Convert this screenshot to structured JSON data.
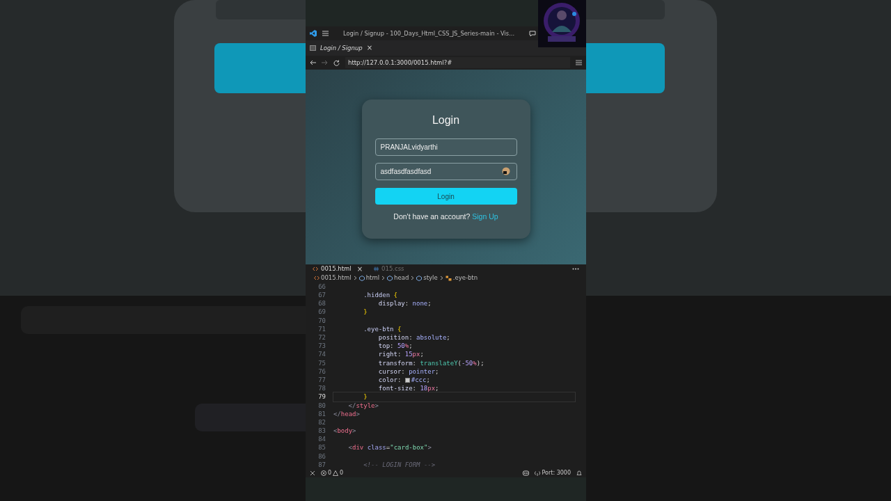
{
  "window": {
    "title": "Login / Signup - 100_Days_Html_CSS_JS_Series-main - Vis..."
  },
  "browser_tab": {
    "label": "Login / Signup",
    "close": "×"
  },
  "address_bar": {
    "url": "http://127.0.0.1:3000/0015.html?#"
  },
  "login_card": {
    "title": "Login",
    "username": {
      "value": "PRANJALvidyarthi"
    },
    "password": {
      "value": "asdfasdfasdfasd"
    },
    "button": "Login",
    "prompt": "Don't have an account?",
    "link": "Sign Up"
  },
  "editor_tabs": [
    {
      "label": "0015.html",
      "kind": "html",
      "selected": true,
      "close": "×"
    },
    {
      "label": "015.css",
      "kind": "css",
      "selected": false
    }
  ],
  "breadcrumb": [
    {
      "label": "0015.html",
      "kind": "file"
    },
    {
      "label": "html",
      "kind": "element"
    },
    {
      "label": "head",
      "kind": "element"
    },
    {
      "label": "style",
      "kind": "element"
    },
    {
      "label": ".eye-btn",
      "kind": "rule"
    }
  ],
  "code": [
    {
      "number": "66",
      "current": false
    },
    {
      "number": "67",
      "current": false,
      "kind": "level2",
      "tokens": [
        {
          "kind": "selector",
          "text": ".hidden"
        },
        {
          "kind": "brace",
          "text": " {"
        }
      ]
    },
    {
      "number": "68",
      "current": false,
      "kind": "level3",
      "tokens": [
        {
          "kind": "property",
          "text": "display"
        },
        {
          "kind": "punct",
          "text": ": "
        },
        {
          "kind": "value",
          "text": "none"
        },
        {
          "kind": "punct",
          "text": ";"
        }
      ]
    },
    {
      "number": "69",
      "current": false,
      "kind": "level2",
      "tokens": [
        {
          "kind": "brace",
          "text": "}"
        }
      ]
    },
    {
      "number": "70",
      "current": false
    },
    {
      "number": "71",
      "current": false,
      "kind": "level2",
      "tokens": [
        {
          "kind": "selector",
          "text": ".eye-btn"
        },
        {
          "kind": "brace",
          "text": " {"
        }
      ]
    },
    {
      "number": "72",
      "current": false,
      "kind": "level3",
      "tokens": [
        {
          "kind": "property",
          "text": "position"
        },
        {
          "kind": "punct",
          "text": ": "
        },
        {
          "kind": "value",
          "text": "absolute"
        },
        {
          "kind": "punct",
          "text": ";"
        }
      ]
    },
    {
      "number": "73",
      "current": false,
      "kind": "level3",
      "tokens": [
        {
          "kind": "property",
          "text": "top"
        },
        {
          "kind": "punct",
          "text": ": "
        },
        {
          "kind": "number",
          "text": "50"
        },
        {
          "kind": "unit",
          "text": "%"
        },
        {
          "kind": "punct",
          "text": ";"
        }
      ]
    },
    {
      "number": "74",
      "current": false,
      "kind": "level3",
      "tokens": [
        {
          "kind": "property",
          "text": "right"
        },
        {
          "kind": "punct",
          "text": ": "
        },
        {
          "kind": "number",
          "text": "15"
        },
        {
          "kind": "unit",
          "text": "px"
        },
        {
          "kind": "punct",
          "text": ";"
        }
      ]
    },
    {
      "number": "75",
      "current": false,
      "kind": "level3",
      "tokens": [
        {
          "kind": "property",
          "text": "transform"
        },
        {
          "kind": "punct",
          "text": ": "
        },
        {
          "kind": "function",
          "text": "translateY"
        },
        {
          "kind": "punct",
          "text": "("
        },
        {
          "kind": "number",
          "text": "-50"
        },
        {
          "kind": "unit",
          "text": "%"
        },
        {
          "kind": "punct",
          "text": ");"
        }
      ]
    },
    {
      "number": "76",
      "current": false,
      "kind": "level3",
      "tokens": [
        {
          "kind": "property",
          "text": "cursor"
        },
        {
          "kind": "punct",
          "text": ": "
        },
        {
          "kind": "value",
          "text": "pointer"
        },
        {
          "kind": "punct",
          "text": ";"
        }
      ]
    },
    {
      "number": "77",
      "current": false,
      "kind": "level3",
      "tokens": [
        {
          "kind": "property",
          "text": "color"
        },
        {
          "kind": "punct",
          "text": ": "
        },
        {
          "kind": "swatch",
          "color": "#cccccc"
        },
        {
          "kind": "value",
          "text": "#ccc"
        },
        {
          "kind": "punct",
          "text": ";"
        }
      ]
    },
    {
      "number": "78",
      "current": false,
      "kind": "level3",
      "tokens": [
        {
          "kind": "property",
          "text": "font-size"
        },
        {
          "kind": "punct",
          "text": ": "
        },
        {
          "kind": "number",
          "text": "18"
        },
        {
          "kind": "unit",
          "text": "px"
        },
        {
          "kind": "punct",
          "text": ";"
        }
      ]
    },
    {
      "number": "79",
      "current": true,
      "kind": "level2",
      "tokens": [
        {
          "kind": "brace",
          "text": "}"
        }
      ]
    },
    {
      "number": "80",
      "current": false,
      "kind": "level1",
      "tokens": [
        {
          "kind": "bracket",
          "text": "</"
        },
        {
          "kind": "tag",
          "text": "style"
        },
        {
          "kind": "bracket",
          "text": ">"
        }
      ]
    },
    {
      "number": "81",
      "current": false,
      "tokens": [
        {
          "kind": "bracket",
          "text": "</"
        },
        {
          "kind": "tag",
          "text": "head"
        },
        {
          "kind": "bracket",
          "text": ">"
        }
      ]
    },
    {
      "number": "82",
      "current": false
    },
    {
      "number": "83",
      "current": false,
      "tokens": [
        {
          "kind": "bracket",
          "text": "<"
        },
        {
          "kind": "tag",
          "text": "body"
        },
        {
          "kind": "bracket",
          "text": ">"
        }
      ]
    },
    {
      "number": "84",
      "current": false
    },
    {
      "number": "85",
      "current": false,
      "kind": "level1",
      "tokens": [
        {
          "kind": "bracket",
          "text": "<"
        },
        {
          "kind": "tag",
          "text": "div"
        },
        {
          "kind": "attr",
          "text": " class"
        },
        {
          "kind": "punct",
          "text": "="
        },
        {
          "kind": "string",
          "text": "\"card-box\""
        },
        {
          "kind": "bracket",
          "text": ">"
        }
      ]
    },
    {
      "number": "86",
      "current": false
    },
    {
      "number": "87",
      "current": false,
      "kind": "level2",
      "tokens": [
        {
          "kind": "comment",
          "text": "<!-- LOGIN FORM -->"
        }
      ]
    }
  ],
  "status_bar": {
    "errors": "0",
    "warnings": "0",
    "port": "Port: 3000"
  }
}
